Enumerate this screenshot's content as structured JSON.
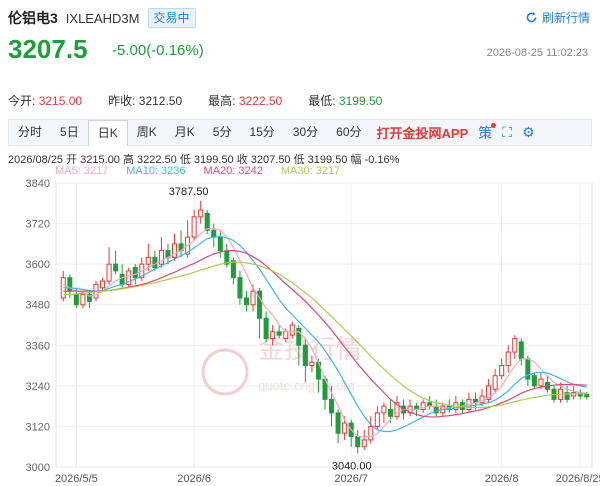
{
  "header": {
    "name": "伦铝电3",
    "code": "IXLEAHD3M",
    "status": "交易中",
    "refresh": "刷新行情"
  },
  "quote": {
    "price": "3207.5",
    "change": "-5.00(-0.16%)",
    "datetime": "2026-08-25 11:02:23"
  },
  "stats": {
    "open_label": "今开:",
    "open": "3215.00",
    "prev_label": "昨收:",
    "prev": "3212.50",
    "high_label": "最高:",
    "high": "3222.50",
    "low_label": "最低:",
    "low": "3199.50"
  },
  "tabs": [
    "分时",
    "5日",
    "日K",
    "周K",
    "月K",
    "5分",
    "15分",
    "30分",
    "60分"
  ],
  "active_tab": "日K",
  "app_link": "打开金投网APP",
  "toolbar_icons": [
    "strategy-icon",
    "fullscreen-icon",
    "settings-icon"
  ],
  "ohlc_line": "2026/08/25  开 3215.00  高 3222.50  低 3199.50  收 3207.50  低 3199.50  幅 -0.16%",
  "ma_legend": [
    {
      "label": "MA5: 3217",
      "color": "#f4a6c0"
    },
    {
      "label": "MA10: 3236",
      "color": "#3db8e8"
    },
    {
      "label": "MA20: 3242",
      "color": "#e0457b"
    },
    {
      "label": "MA30: 3217",
      "color": "#a7cf4a"
    }
  ],
  "watermark": {
    "cn": "金投行情",
    "en": "quote.cngold.org"
  },
  "colors": {
    "up": "#e53935",
    "down": "#1e9e3a",
    "accent": "#2a7fd6"
  },
  "chart_data": {
    "type": "candlestick",
    "ylim": [
      3000,
      3840
    ],
    "y_ticks": [
      "3840",
      "3720",
      "3600",
      "3480",
      "3360",
      "3240",
      "3120",
      "3000"
    ],
    "x_ticks": [
      "2026/5/5",
      "2026/6",
      "2026/7",
      "2026/8",
      "2026/8/25"
    ],
    "annotations": [
      {
        "label": "3787.50"
      },
      {
        "label": "3040.00"
      }
    ],
    "candles": [
      [
        3500,
        3560,
        3580,
        3490
      ],
      [
        3560,
        3520,
        3570,
        3500
      ],
      [
        3510,
        3480,
        3530,
        3470
      ],
      [
        3480,
        3510,
        3520,
        3470
      ],
      [
        3510,
        3490,
        3520,
        3470
      ],
      [
        3500,
        3540,
        3550,
        3490
      ],
      [
        3530,
        3550,
        3560,
        3520
      ],
      [
        3550,
        3600,
        3650,
        3540
      ],
      [
        3600,
        3580,
        3640,
        3570
      ],
      [
        3570,
        3540,
        3600,
        3530
      ],
      [
        3540,
        3580,
        3590,
        3530
      ],
      [
        3590,
        3560,
        3600,
        3540
      ],
      [
        3560,
        3600,
        3620,
        3550
      ],
      [
        3600,
        3620,
        3660,
        3580
      ],
      [
        3620,
        3590,
        3640,
        3580
      ],
      [
        3600,
        3640,
        3680,
        3590
      ],
      [
        3640,
        3620,
        3660,
        3600
      ],
      [
        3620,
        3660,
        3690,
        3610
      ],
      [
        3660,
        3640,
        3700,
        3620
      ],
      [
        3630,
        3680,
        3730,
        3620
      ],
      [
        3680,
        3740,
        3760,
        3670
      ],
      [
        3740,
        3760,
        3787.5,
        3720
      ],
      [
        3750,
        3700,
        3760,
        3690
      ],
      [
        3700,
        3680,
        3720,
        3650
      ],
      [
        3680,
        3640,
        3700,
        3620
      ],
      [
        3640,
        3600,
        3660,
        3590
      ],
      [
        3610,
        3560,
        3620,
        3540
      ],
      [
        3560,
        3500,
        3580,
        3480
      ],
      [
        3500,
        3480,
        3520,
        3460
      ],
      [
        3480,
        3520,
        3540,
        3460
      ],
      [
        3520,
        3440,
        3530,
        3380
      ],
      [
        3440,
        3380,
        3460,
        3370
      ],
      [
        3380,
        3400,
        3420,
        3360
      ],
      [
        3400,
        3390,
        3420,
        3380
      ],
      [
        3380,
        3400,
        3410,
        3370
      ],
      [
        3390,
        3420,
        3430,
        3380
      ],
      [
        3410,
        3360,
        3420,
        3300
      ],
      [
        3360,
        3300,
        3380,
        3250
      ],
      [
        3300,
        3310,
        3330,
        3280
      ],
      [
        3310,
        3260,
        3320,
        3220
      ],
      [
        3260,
        3200,
        3270,
        3170
      ],
      [
        3200,
        3160,
        3240,
        3120
      ],
      [
        3160,
        3100,
        3170,
        3070
      ],
      [
        3100,
        3130,
        3150,
        3080
      ],
      [
        3130,
        3090,
        3140,
        3060
      ],
      [
        3090,
        3060,
        3110,
        3040
      ],
      [
        3060,
        3080,
        3110,
        3050
      ],
      [
        3080,
        3120,
        3150,
        3070
      ],
      [
        3120,
        3160,
        3180,
        3110
      ],
      [
        3160,
        3180,
        3190,
        3130
      ],
      [
        3170,
        3150,
        3200,
        3130
      ],
      [
        3150,
        3190,
        3210,
        3140
      ],
      [
        3180,
        3160,
        3200,
        3140
      ],
      [
        3160,
        3180,
        3200,
        3150
      ],
      [
        3180,
        3170,
        3190,
        3150
      ],
      [
        3170,
        3190,
        3200,
        3160
      ],
      [
        3190,
        3180,
        3210,
        3170
      ],
      [
        3180,
        3160,
        3200,
        3150
      ],
      [
        3160,
        3180,
        3190,
        3150
      ],
      [
        3180,
        3170,
        3200,
        3160
      ],
      [
        3170,
        3190,
        3210,
        3160
      ],
      [
        3190,
        3170,
        3200,
        3160
      ],
      [
        3170,
        3200,
        3220,
        3160
      ],
      [
        3200,
        3190,
        3220,
        3170
      ],
      [
        3190,
        3210,
        3230,
        3180
      ],
      [
        3200,
        3240,
        3260,
        3190
      ],
      [
        3230,
        3270,
        3290,
        3220
      ],
      [
        3270,
        3300,
        3320,
        3260
      ],
      [
        3300,
        3340,
        3360,
        3280
      ],
      [
        3340,
        3380,
        3390,
        3320
      ],
      [
        3370,
        3320,
        3380,
        3300
      ],
      [
        3320,
        3260,
        3330,
        3240
      ],
      [
        3270,
        3240,
        3280,
        3230
      ],
      [
        3240,
        3260,
        3280,
        3230
      ],
      [
        3250,
        3230,
        3270,
        3220
      ],
      [
        3230,
        3200,
        3240,
        3190
      ],
      [
        3200,
        3230,
        3250,
        3190
      ],
      [
        3220,
        3200,
        3240,
        3190
      ],
      [
        3210,
        3220,
        3240,
        3200
      ],
      [
        3220,
        3210,
        3230,
        3200
      ],
      [
        3215,
        3207.5,
        3222.5,
        3199.5
      ]
    ],
    "ma_lines": {
      "MA5": [
        3540,
        3530,
        3520,
        3515,
        3505,
        3510,
        3520,
        3535,
        3550,
        3560,
        3565,
        3570,
        3580,
        3590,
        3600,
        3610,
        3620,
        3630,
        3640,
        3655,
        3670,
        3690,
        3705,
        3705,
        3700,
        3680,
        3650,
        3610,
        3570,
        3530,
        3500,
        3470,
        3450,
        3420,
        3400,
        3400,
        3400,
        3380,
        3350,
        3310,
        3260,
        3220,
        3180,
        3140,
        3110,
        3090,
        3090,
        3090,
        3100,
        3120,
        3140,
        3160,
        3170,
        3170,
        3170,
        3175,
        3180,
        3180,
        3175,
        3175,
        3175,
        3180,
        3185,
        3190,
        3195,
        3205,
        3220,
        3240,
        3270,
        3300,
        3320,
        3320,
        3310,
        3290,
        3270,
        3250,
        3240,
        3230,
        3225,
        3220,
        3217
      ],
      "MA10": [
        3530,
        3530,
        3528,
        3525,
        3522,
        3520,
        3522,
        3528,
        3535,
        3540,
        3548,
        3556,
        3565,
        3575,
        3585,
        3595,
        3605,
        3615,
        3625,
        3635,
        3648,
        3662,
        3675,
        3680,
        3682,
        3678,
        3670,
        3655,
        3635,
        3610,
        3585,
        3555,
        3525,
        3495,
        3470,
        3450,
        3430,
        3410,
        3390,
        3370,
        3345,
        3315,
        3285,
        3250,
        3215,
        3180,
        3150,
        3125,
        3110,
        3105,
        3105,
        3110,
        3118,
        3128,
        3138,
        3148,
        3158,
        3165,
        3170,
        3172,
        3175,
        3178,
        3180,
        3183,
        3186,
        3190,
        3198,
        3210,
        3225,
        3245,
        3262,
        3272,
        3278,
        3280,
        3278,
        3270,
        3262,
        3252,
        3245,
        3240,
        3236
      ],
      "MA20": [
        3520,
        3520,
        3520,
        3520,
        3520,
        3520,
        3520,
        3522,
        3525,
        3528,
        3532,
        3536,
        3540,
        3545,
        3552,
        3560,
        3568,
        3576,
        3585,
        3594,
        3602,
        3612,
        3622,
        3630,
        3636,
        3640,
        3640,
        3638,
        3632,
        3622,
        3610,
        3595,
        3578,
        3560,
        3542,
        3525,
        3508,
        3490,
        3470,
        3450,
        3428,
        3405,
        3380,
        3355,
        3330,
        3305,
        3282,
        3260,
        3240,
        3220,
        3200,
        3185,
        3172,
        3162,
        3155,
        3150,
        3148,
        3148,
        3150,
        3152,
        3155,
        3158,
        3162,
        3166,
        3170,
        3176,
        3182,
        3190,
        3198,
        3208,
        3218,
        3226,
        3232,
        3236,
        3240,
        3242,
        3244,
        3244,
        3244,
        3243,
        3242
      ],
      "MA30": [
        3510,
        3510,
        3512,
        3514,
        3516,
        3518,
        3520,
        3522,
        3524,
        3527,
        3530,
        3533,
        3537,
        3541,
        3545,
        3550,
        3555,
        3560,
        3565,
        3570,
        3576,
        3582,
        3588,
        3594,
        3600,
        3604,
        3606,
        3606,
        3604,
        3600,
        3595,
        3588,
        3580,
        3570,
        3558,
        3545,
        3530,
        3515,
        3500,
        3482,
        3464,
        3445,
        3426,
        3407,
        3388,
        3368,
        3348,
        3328,
        3308,
        3290,
        3272,
        3255,
        3240,
        3226,
        3214,
        3204,
        3196,
        3190,
        3186,
        3182,
        3180,
        3178,
        3176,
        3176,
        3176,
        3178,
        3180,
        3184,
        3188,
        3193,
        3198,
        3202,
        3206,
        3209,
        3212,
        3214,
        3215,
        3216,
        3216,
        3217,
        3217
      ]
    }
  }
}
